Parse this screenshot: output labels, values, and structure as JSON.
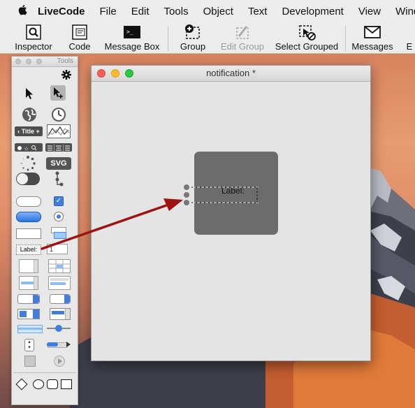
{
  "menubar": {
    "apple": "",
    "app": "LiveCode",
    "items": [
      "File",
      "Edit",
      "Tools",
      "Object",
      "Text",
      "Development",
      "View",
      "Window"
    ]
  },
  "toolbar": {
    "buttons": [
      {
        "label": "Inspector",
        "icon": "inspector-icon",
        "enabled": true
      },
      {
        "label": "Code",
        "icon": "code-icon",
        "enabled": true
      },
      {
        "label": "Message Box",
        "icon": "message-box-icon",
        "enabled": true
      },
      {
        "label": "Group",
        "icon": "group-icon",
        "enabled": true
      },
      {
        "label": "Edit Group",
        "icon": "edit-group-icon",
        "enabled": false
      },
      {
        "label": "Select Grouped",
        "icon": "select-grouped-icon",
        "enabled": true
      },
      {
        "label": "Messages",
        "icon": "messages-icon",
        "enabled": true
      },
      {
        "label": "E",
        "icon": "",
        "enabled": true
      }
    ]
  },
  "tools_palette": {
    "title": "Tools",
    "title_widget_label": "Title",
    "svg_widget_label": "SVG",
    "label_tool_text": "Label:",
    "field_tool_text": "1"
  },
  "notification_window": {
    "title": "notification *",
    "label_field": "Label:"
  },
  "colors": {
    "arrow": "#9e1212",
    "desktop_accent": "#e08d67"
  }
}
